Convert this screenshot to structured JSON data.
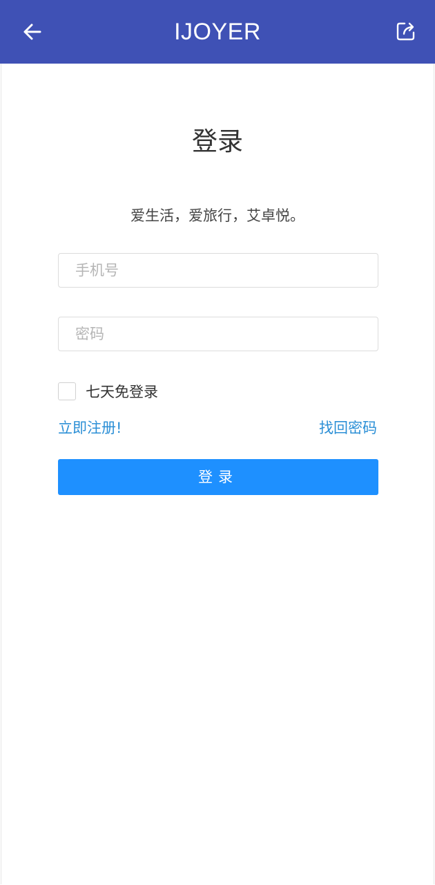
{
  "app_bar": {
    "title": "IJOYER",
    "back_icon": "arrow-left-icon",
    "share_icon": "share-icon",
    "color": "#3f51b5"
  },
  "login": {
    "title": "登录",
    "slogan": "爱生活，爱旅行，艾卓悦。",
    "phone_placeholder": "手机号",
    "phone_value": "",
    "password_placeholder": "密码",
    "password_value": "",
    "remember_label": "七天免登录",
    "remember_checked": false,
    "register_link": "立即注册!",
    "forgot_link": "找回密码",
    "submit_label": "登录",
    "submit_color": "#1e90ff",
    "link_color": "#2b8fd6"
  }
}
